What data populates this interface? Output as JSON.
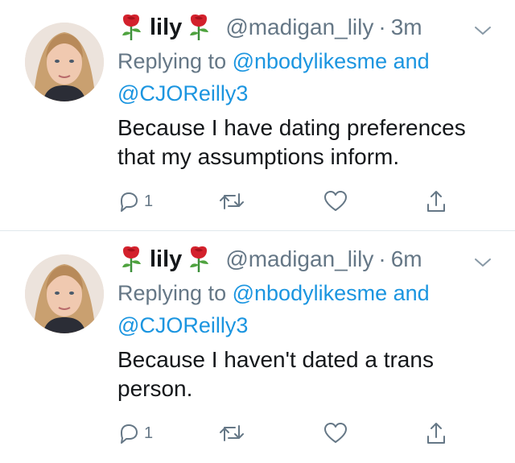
{
  "colors": {
    "accent": "#1b95e0",
    "muted": "#657786",
    "text": "#14171a",
    "divider": "#e1e8ed",
    "rose": "#d3212c"
  },
  "tweets": [
    {
      "name": "lily",
      "handle": "@madigan_lily",
      "dot": "·",
      "time": "3m",
      "replying_prefix": "Replying to",
      "mention1": "@nbodylikesme",
      "and": "and",
      "mention2": "@CJOReilly3",
      "text": "Because I have dating preferences that my assumptions inform.",
      "reply_count": "1",
      "icons": [
        "reply-icon",
        "retweet-icon",
        "like-icon",
        "share-icon"
      ]
    },
    {
      "name": "lily",
      "handle": "@madigan_lily",
      "dot": "·",
      "time": "6m",
      "replying_prefix": "Replying to",
      "mention1": "@nbodylikesme",
      "and": "and",
      "mention2": "@CJOReilly3",
      "text": "Because I haven't dated a trans person.",
      "reply_count": "1",
      "icons": [
        "reply-icon",
        "retweet-icon",
        "like-icon",
        "share-icon"
      ]
    }
  ]
}
